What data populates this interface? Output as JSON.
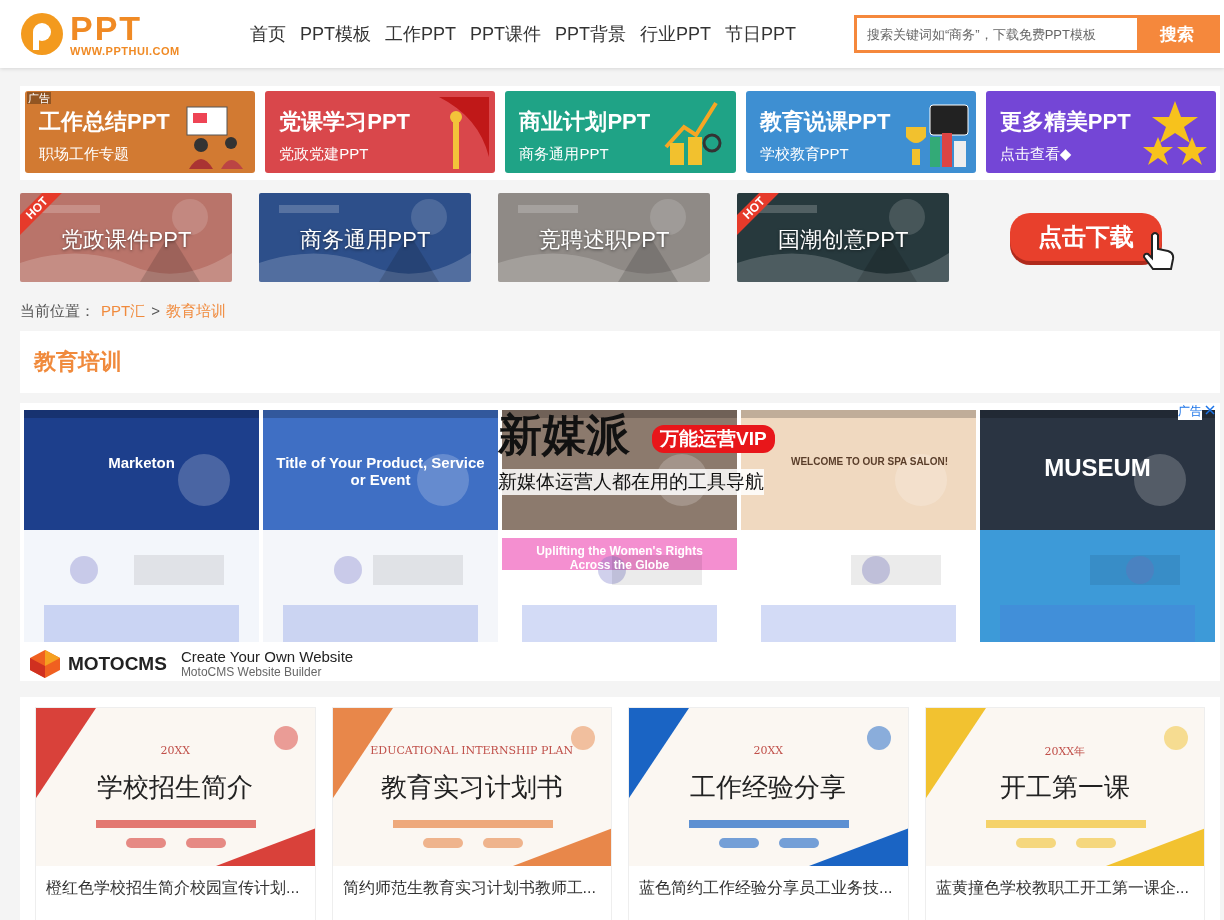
{
  "header": {
    "logo": {
      "wordmark": "PPT",
      "url": "WWW.PPTHUI.COM"
    },
    "nav": [
      {
        "label": "首页"
      },
      {
        "label": "PPT模板"
      },
      {
        "label": "工作PPT"
      },
      {
        "label": "PPT课件"
      },
      {
        "label": "PPT背景"
      },
      {
        "label": "行业PPT"
      },
      {
        "label": "节日PPT"
      }
    ],
    "search": {
      "placeholder": "搜索关键词如“商务”，下载免费PPT模板",
      "button": "搜索"
    }
  },
  "promo_banners": [
    {
      "title": "工作总结PPT",
      "subtitle": "职场工作专题",
      "color": "#d27a32",
      "kind": "people",
      "ad_tag": "广告"
    },
    {
      "title": "党课学习PPT",
      "subtitle": "党政党建PPT",
      "color": "#d9474b",
      "kind": "flag"
    },
    {
      "title": "商业计划PPT",
      "subtitle": "商务通用PPT",
      "color": "#1fa386",
      "kind": "coins"
    },
    {
      "title": "教育说课PPT",
      "subtitle": "学校教育PPT",
      "color": "#3e8fd2",
      "kind": "trophy"
    },
    {
      "title": "更多精美PPT",
      "subtitle": "点击查看◆",
      "color": "#7446d6",
      "kind": "stars"
    }
  ],
  "hot_banners": [
    {
      "label": "党政课件PPT",
      "ribbon": "HOT"
    },
    {
      "label": "商务通用PPT"
    },
    {
      "label": "竞聘述职PPT"
    },
    {
      "label": "国潮创意PPT",
      "ribbon": "HOT"
    }
  ],
  "download_button": "点击下载",
  "breadcrumb": {
    "label": "当前位置：",
    "items": [
      "PPT汇",
      "教育培训"
    ],
    "separator": ">"
  },
  "section_title": "教育培训",
  "ad": {
    "tag": "广告",
    "thumbnails": [
      {
        "headline": "Marketon"
      },
      {
        "headline": "Title of Your Product, Service or Event"
      },
      {
        "headline": "Uplifting the Women's Rights Across the Globe"
      },
      {
        "headline": "WELCOME TO OUR SPA SALON!"
      },
      {
        "headline": "MUSEUM"
      }
    ],
    "overlay": {
      "title": "新媒派",
      "badge": "万能运营VIP",
      "subtitle": "新媒体运营人都在用的工具导航"
    },
    "brand": "MOTOCMS",
    "headline": "Create Your Own Website",
    "sub": "MotoCMS Website Builder"
  },
  "cards": [
    {
      "title": "橙红色学校招生简介校园宣传计划...",
      "thumb_title": "学校招生简介",
      "thumb_sub": "20XX"
    },
    {
      "title": "简约师范生教育实习计划书教师工...",
      "thumb_title": "教育实习计划书",
      "thumb_sub": "EDUCATIONAL INTERNSHIP PLAN"
    },
    {
      "title": "蓝色简约工作经验分享员工业务技...",
      "thumb_title": "工作经验分享",
      "thumb_sub": "20XX"
    },
    {
      "title": "蓝黄撞色学校教职工开工第一课企...",
      "thumb_title": "开工第一课",
      "thumb_sub": "20XX年"
    }
  ]
}
